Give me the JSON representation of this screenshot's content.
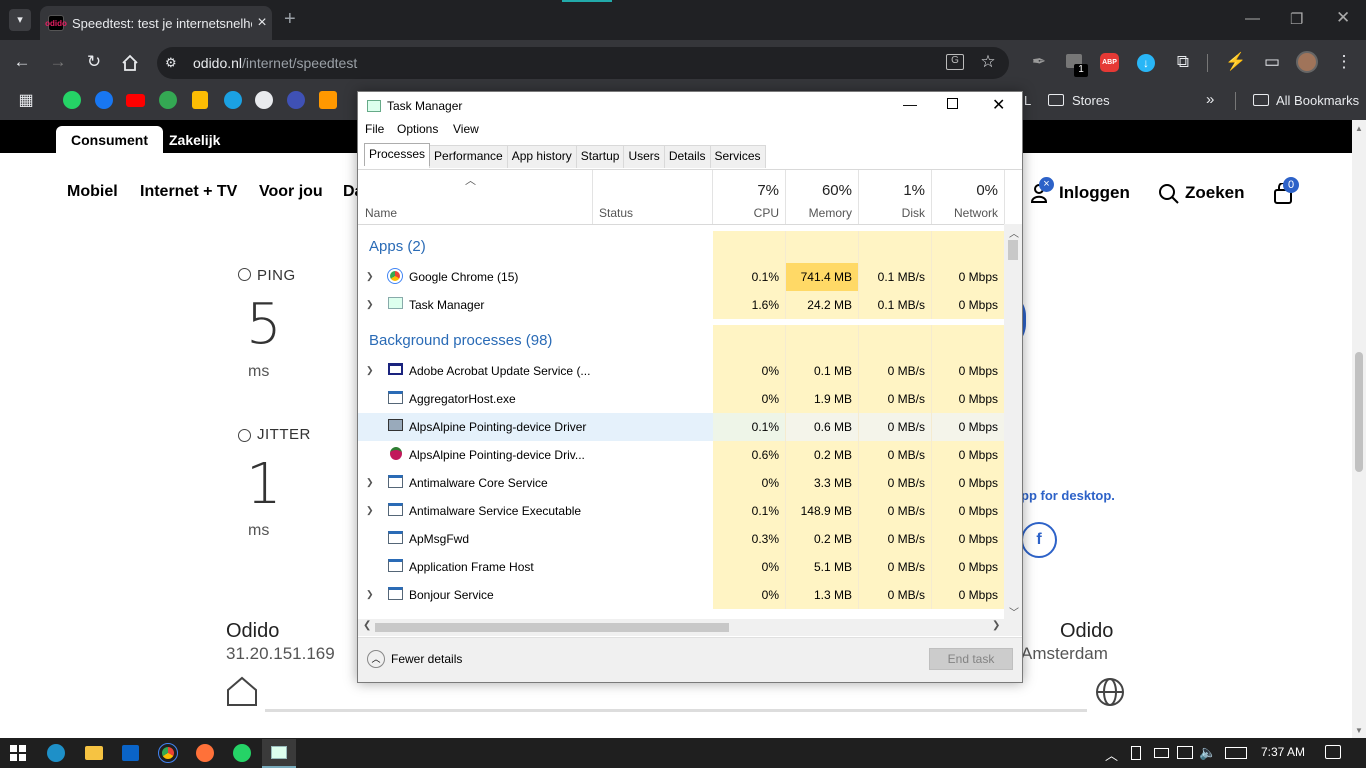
{
  "browser": {
    "tab_title": "Speedtest: test je internetsnelhe",
    "tab_favicon_text": "odido",
    "new_tab": "+",
    "url_domain": "odido.nl",
    "url_path": "/internet/speedtest",
    "bookmarks": [
      {
        "label": "L"
      },
      {
        "label": "Stores"
      },
      {
        "label": "All Bookmarks"
      }
    ],
    "extension_badge": "1",
    "abp_label": "ABP"
  },
  "page": {
    "segments": {
      "consumer": "Consument",
      "business": "Zakelijk"
    },
    "nav": [
      "Mobiel",
      "Internet + TV",
      "Voor jou",
      "Da"
    ],
    "login": "Inloggen",
    "search": "Zoeken",
    "cart_count": "0",
    "login_badge": "×",
    "ping": {
      "label": "PING",
      "value": "5",
      "unit": "ms"
    },
    "jitter": {
      "label": "JITTER",
      "value": "1",
      "unit": "ms"
    },
    "app_text": "pp for desktop.",
    "provider_left": {
      "name": "Odido",
      "ip": "31.20.151.169"
    },
    "provider_right": {
      "name": "Odido",
      "city": "Amsterdam"
    }
  },
  "taskmanager": {
    "title": "Task Manager",
    "menu": [
      "File",
      "Options",
      "View"
    ],
    "tabs": [
      "Processes",
      "Performance",
      "App history",
      "Startup",
      "Users",
      "Details",
      "Services"
    ],
    "active_tab": "Processes",
    "columns": {
      "name": "Name",
      "status": "Status",
      "cpu": {
        "pct": "7%",
        "label": "CPU"
      },
      "memory": {
        "pct": "60%",
        "label": "Memory"
      },
      "disk": {
        "pct": "1%",
        "label": "Disk"
      },
      "network": {
        "pct": "0%",
        "label": "Network"
      }
    },
    "groups": {
      "apps": "Apps (2)",
      "background": "Background processes (98)"
    },
    "apps": [
      {
        "name": "Google Chrome (15)",
        "cpu": "0.1%",
        "mem": "741.4 MB",
        "disk": "0.1 MB/s",
        "net": "0 Mbps",
        "expand": true,
        "icon": "chrome-icon"
      },
      {
        "name": "Task Manager",
        "cpu": "1.6%",
        "mem": "24.2 MB",
        "disk": "0.1 MB/s",
        "net": "0 Mbps",
        "expand": true,
        "icon": "task-manager-icon"
      }
    ],
    "background": [
      {
        "name": "Adobe Acrobat Update Service (...",
        "cpu": "0%",
        "mem": "0.1 MB",
        "disk": "0 MB/s",
        "net": "0 Mbps",
        "expand": true,
        "icon": "window-icon"
      },
      {
        "name": "AggregatorHost.exe",
        "cpu": "0%",
        "mem": "1.9 MB",
        "disk": "0 MB/s",
        "net": "0 Mbps",
        "expand": false,
        "icon": "service-icon"
      },
      {
        "name": "AlpsAlpine Pointing-device Driver",
        "cpu": "0.1%",
        "mem": "0.6 MB",
        "disk": "0 MB/s",
        "net": "0 Mbps",
        "expand": false,
        "icon": "monitor-icon"
      },
      {
        "name": "AlpsAlpine Pointing-device Driv...",
        "cpu": "0.6%",
        "mem": "0.2 MB",
        "disk": "0 MB/s",
        "net": "0 Mbps",
        "expand": false,
        "icon": "raspberry-icon"
      },
      {
        "name": "Antimalware Core Service",
        "cpu": "0%",
        "mem": "3.3 MB",
        "disk": "0 MB/s",
        "net": "0 Mbps",
        "expand": true,
        "icon": "service-icon"
      },
      {
        "name": "Antimalware Service Executable",
        "cpu": "0.1%",
        "mem": "148.9 MB",
        "disk": "0 MB/s",
        "net": "0 Mbps",
        "expand": true,
        "icon": "service-icon"
      },
      {
        "name": "ApMsgFwd",
        "cpu": "0.3%",
        "mem": "0.2 MB",
        "disk": "0 MB/s",
        "net": "0 Mbps",
        "expand": false,
        "icon": "service-icon"
      },
      {
        "name": "Application Frame Host",
        "cpu": "0%",
        "mem": "5.1 MB",
        "disk": "0 MB/s",
        "net": "0 Mbps",
        "expand": false,
        "icon": "service-icon"
      },
      {
        "name": "Bonjour Service",
        "cpu": "0%",
        "mem": "1.3 MB",
        "disk": "0 MB/s",
        "net": "0 Mbps",
        "expand": true,
        "icon": "service-icon"
      }
    ],
    "fewer_details": "Fewer details",
    "end_task": "End task"
  },
  "taskbar": {
    "clock": "7:37 AM"
  },
  "colors": {
    "chrome_dark": "#202124",
    "chrome_toolbar": "#35363a",
    "heat_light": "#fff4c4",
    "heat_strong": "#ffd966",
    "selected_row": "#e5f1fb",
    "link_blue": "#2a6bb6",
    "odido_blue": "#2d62c8"
  }
}
